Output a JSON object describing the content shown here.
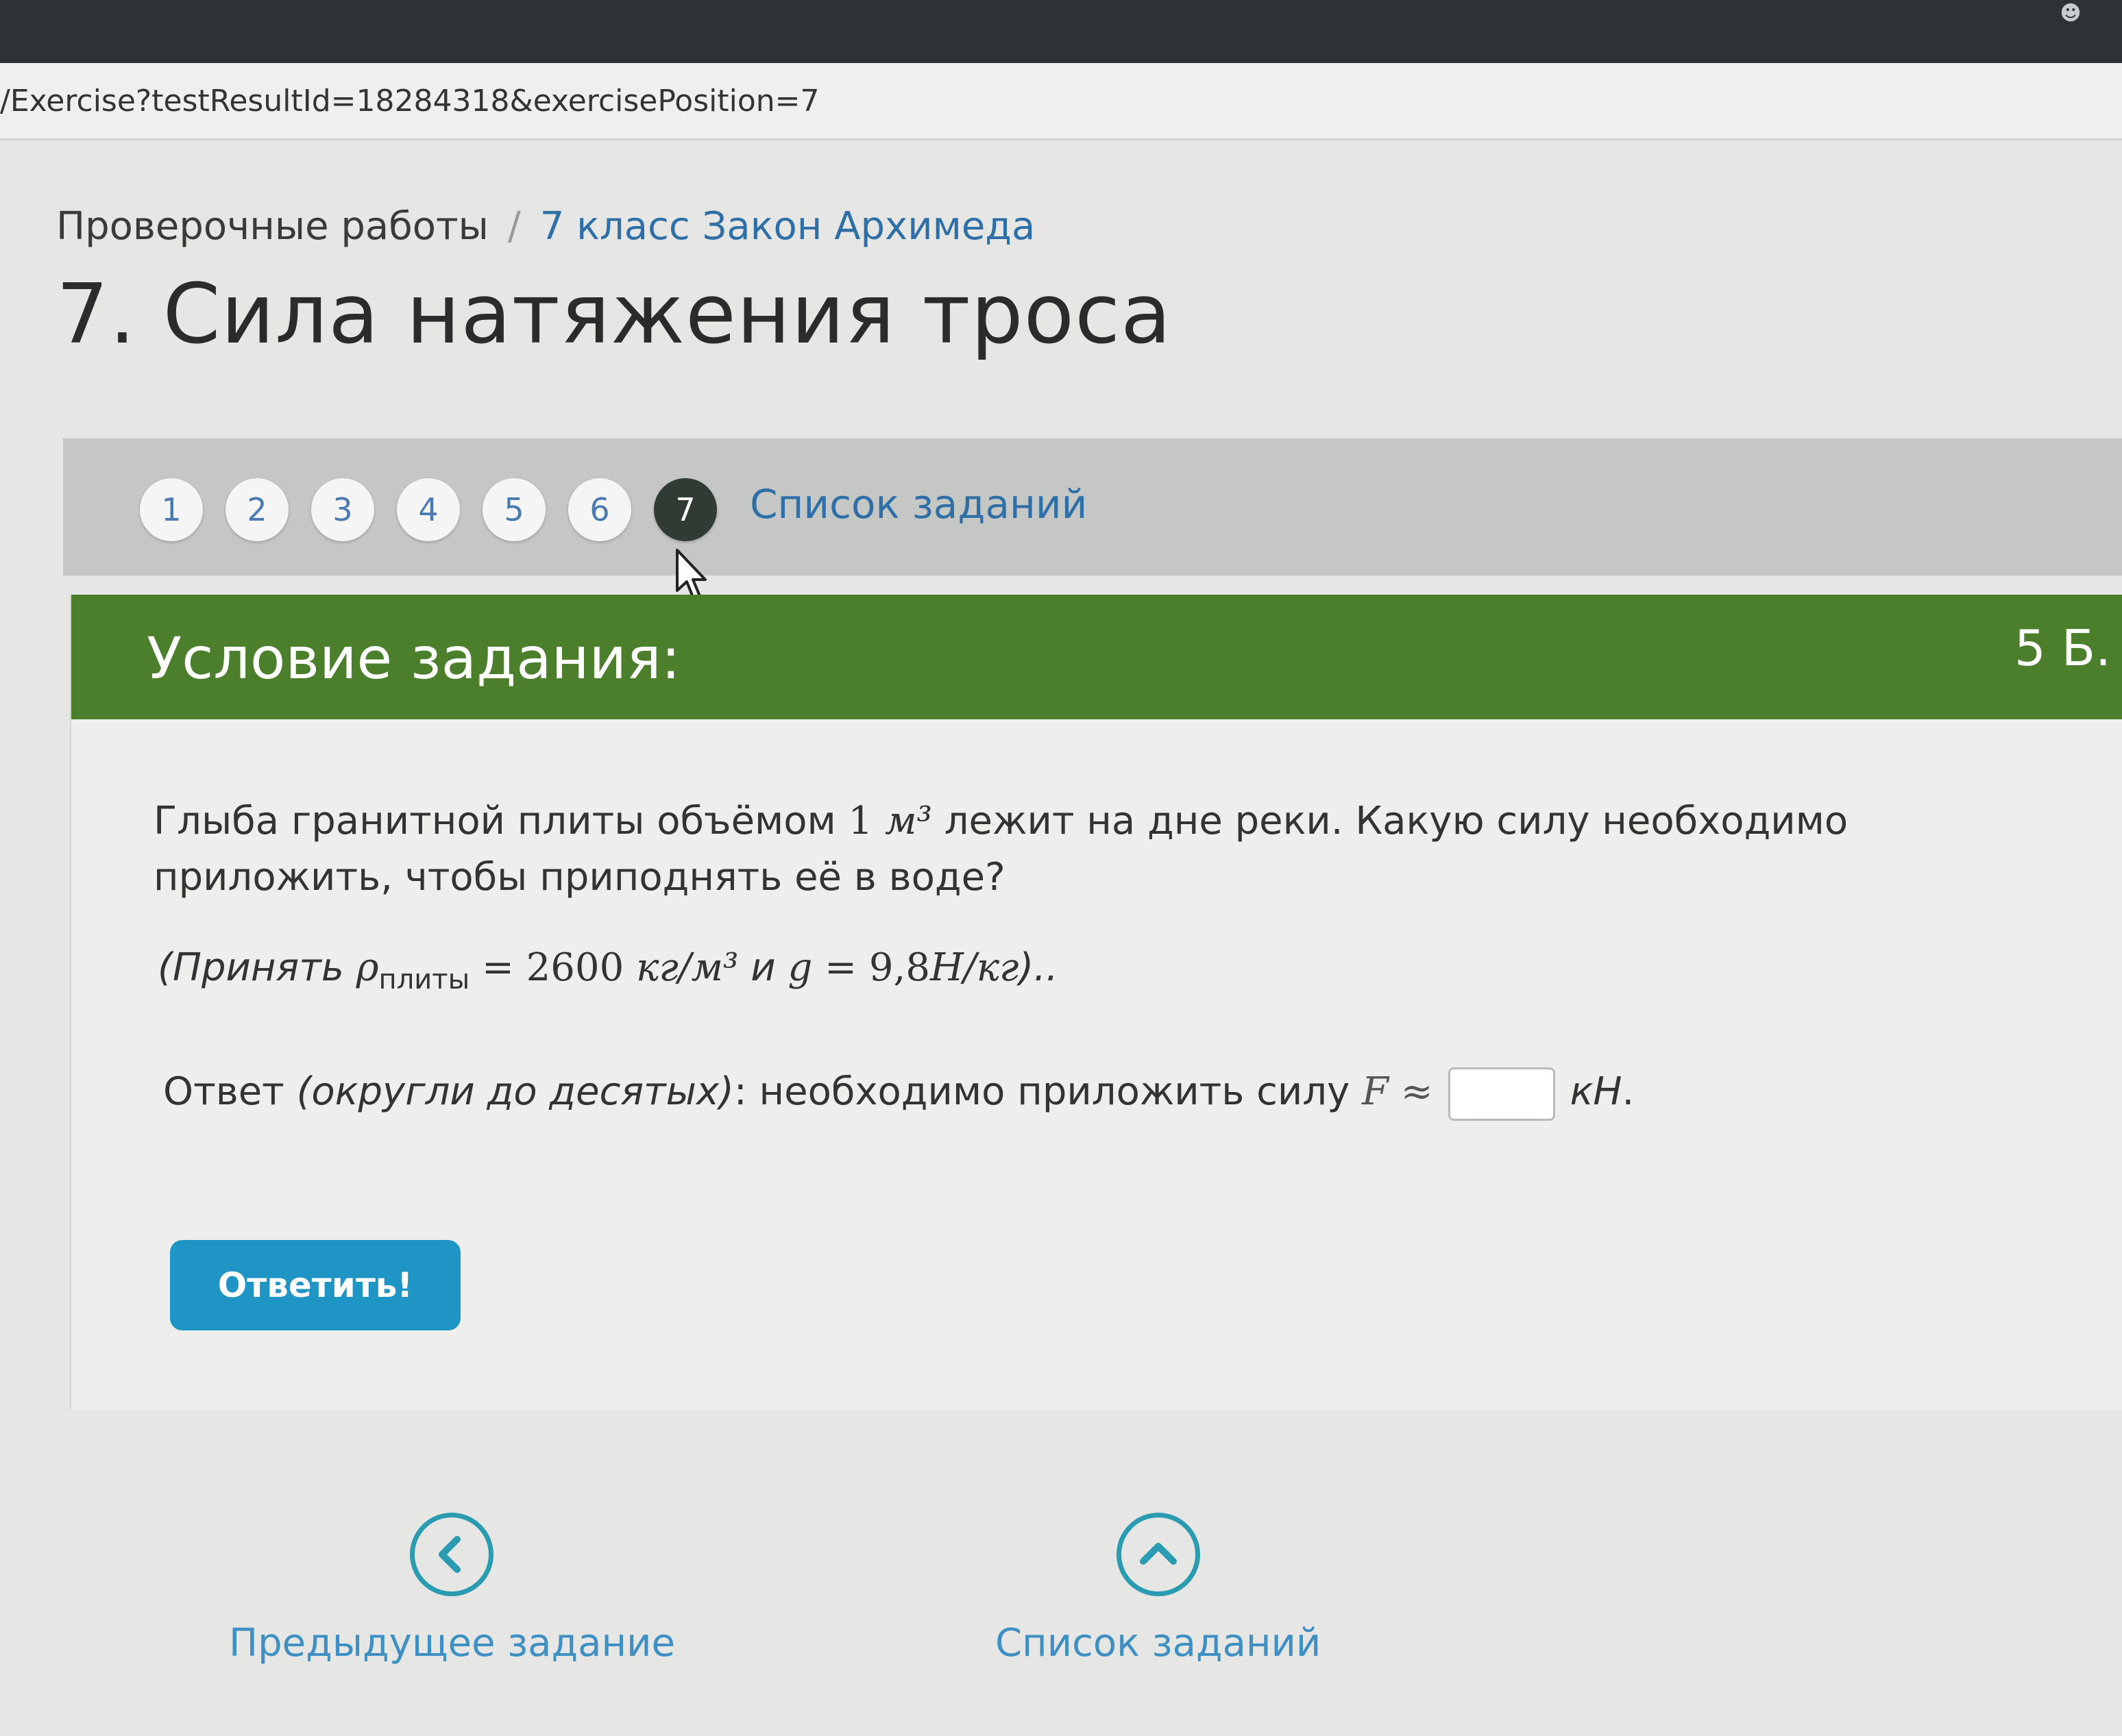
{
  "browser": {
    "url": "/Exercise?testResultId=18284318&exercisePosition=7",
    "account_icon": "person-icon"
  },
  "breadcrumb": {
    "root": "Проверочные работы",
    "separator": "/",
    "current": "7 класс Закон Архимеда"
  },
  "page_title": "7. Сила натяжения троса",
  "task_nav": {
    "steps": [
      "1",
      "2",
      "3",
      "4",
      "5",
      "6",
      "7"
    ],
    "current_step": "7",
    "list_link": "Список заданий"
  },
  "task": {
    "header": "Условие задания:",
    "points": "5 Б.",
    "question_part1": "Глыба гранитной плиты объёмом ",
    "volume_value": "1",
    "volume_unit": "м³",
    "question_part2": " лежит на дне реки. Какую силу необходимо приложить, чтобы приподнять её в воде?",
    "given_prefix": "(Принять ",
    "rho_symbol": "ρ",
    "rho_subscript": "плиты",
    "rho_eq": " = 2600 ",
    "rho_unit": "кг/м³",
    "and_word": " и ",
    "g_symbol": "g",
    "g_eq": " = 9,8",
    "g_unit": "Н/кг",
    "given_suffix": ")..",
    "answer_prefix": "Ответ ",
    "answer_hint": "(округли до десятых)",
    "answer_middle": ": необходимо приложить силу ",
    "answer_symbol": "F ≈",
    "answer_value": "",
    "answer_unit": "кН",
    "answer_suffix": ".",
    "submit_label": "Ответить!"
  },
  "bottom_nav": {
    "prev_label": "Предыдущее задание",
    "list_label": "Список заданий"
  },
  "colors": {
    "header_green": "#4b7f2c",
    "button_blue": "#1f95c6",
    "link_blue": "#2e6fa8",
    "nav_icon_teal": "#2a9bb0"
  }
}
